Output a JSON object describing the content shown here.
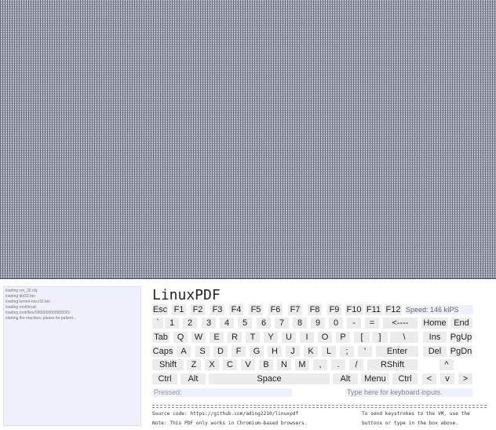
{
  "console": {
    "lines": [
      "loading vm_32.cfg",
      "loading bbl32.bin",
      "loading kernel-riscv32.bin",
      "loading root/head",
      "loading root/files/0000000000000001",
      "starting the machine, please be patient..."
    ]
  },
  "app": {
    "title": "LinuxPDF",
    "speed": "Speed: 146 kIPS"
  },
  "keyboard": {
    "row1": [
      "Esc",
      "F1",
      "F2",
      "F3",
      "F4",
      "F5",
      "F6",
      "F7",
      "F8",
      "F9",
      "F10",
      "F11",
      "F12"
    ],
    "row2": [
      "`",
      "1",
      "2",
      "3",
      "4",
      "5",
      "6",
      "7",
      "8",
      "9",
      "0",
      "-",
      "=",
      "<----",
      "Home",
      "End"
    ],
    "row3": [
      "Tab",
      "Q",
      "W",
      "E",
      "R",
      "T",
      "Y",
      "U",
      "I",
      "O",
      "P",
      "[",
      "]",
      "\\",
      "Ins",
      "PgUp"
    ],
    "row4": [
      "Caps",
      "A",
      "S",
      "D",
      "F",
      "G",
      "H",
      "J",
      "K",
      "L",
      ";",
      "'",
      "Enter",
      "Del",
      "PgDn"
    ],
    "row5": [
      "Shift",
      "Z",
      "X",
      "C",
      "V",
      "B",
      "N",
      "M",
      ",",
      ".",
      "/",
      "RShift",
      "^"
    ],
    "row6": [
      "Ctrl",
      "Alt",
      "Space",
      "Alt",
      "Menu",
      "Ctrl",
      "<",
      "v",
      ">"
    ]
  },
  "fields": {
    "pressed_label": "Pressed:",
    "input_placeholder": "Type here for keyboard inputs."
  },
  "footer": {
    "source": "Source code: https://github.com/ading2210/linuxpdf",
    "note": "Note: This PDF only works in Chromium-based browsers.",
    "hint1": "To send keystrokes to the VM, use the",
    "hint2": "buttons or type in the box above."
  },
  "colors": {
    "terminal_bg": "#b9bcc9",
    "key_bg": "#ececec",
    "panel_bg": "#eef1fb"
  }
}
